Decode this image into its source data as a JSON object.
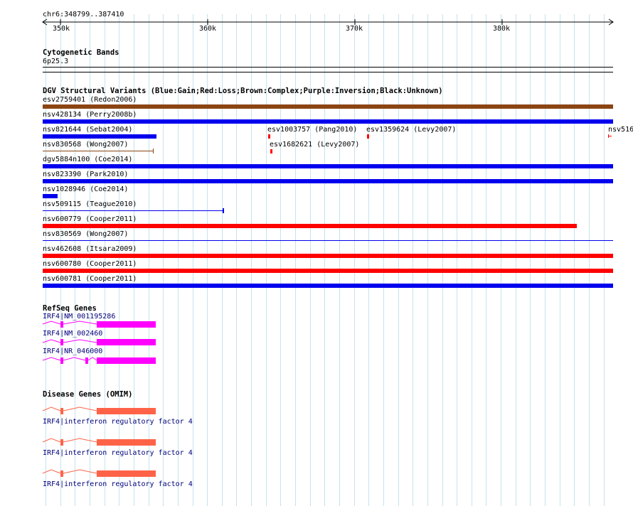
{
  "ruler": {
    "location": "chr6:348799..387410",
    "ticks": [
      "350k",
      "360k",
      "370k",
      "380k"
    ]
  },
  "cytobands": {
    "title": "Cytogenetic Bands",
    "band": "6p25.3"
  },
  "dgv": {
    "title": "DGV Structural Variants (Blue:Gain;Red:Loss;Brown:Complex;Purple:Inversion;Black:Unknown)",
    "colors": {
      "gain": "#0000ee",
      "loss": "#ff0000",
      "complex": "#8b4513"
    },
    "variants": [
      {
        "label": "esv2759401 (Redon2006)",
        "type": "complex"
      },
      {
        "label": "nsv428134 (Perry2008b)",
        "type": "gain"
      },
      {
        "label": "nsv821644 (Sebat2004)",
        "type": "gain"
      },
      {
        "label": "esv1003757 (Pang2010)",
        "type": "loss"
      },
      {
        "label": "esv1359624 (Levy2007)",
        "type": "loss"
      },
      {
        "label": "nsv516",
        "type": "loss"
      },
      {
        "label": "nsv830568 (Wong2007)",
        "type": "complex"
      },
      {
        "label": "esv1682621 (Levy2007)",
        "type": "loss"
      },
      {
        "label": "dgv5884n100 (Coe2014)",
        "type": "gain"
      },
      {
        "label": "nsv823390 (Park2010)",
        "type": "gain"
      },
      {
        "label": "nsv1028946 (Coe2014)",
        "type": "gain"
      },
      {
        "label": "nsv509115 (Teague2010)",
        "type": "gain"
      },
      {
        "label": "nsv600779 (Cooper2011)",
        "type": "loss"
      },
      {
        "label": "nsv830569 (Wong2007)",
        "type": "gain"
      },
      {
        "label": "nsv462608 (Itsara2009)",
        "type": "loss"
      },
      {
        "label": "nsv600780 (Cooper2011)",
        "type": "loss"
      },
      {
        "label": "nsv600781 (Cooper2011)",
        "type": "gain"
      }
    ]
  },
  "refseq": {
    "title": "RefSeq Genes",
    "color": "#ff00ff",
    "genes": [
      {
        "label": "IRF4|NM_001195286"
      },
      {
        "label": "IRF4|NM_002460"
      },
      {
        "label": "IRF4|NR_046000"
      }
    ]
  },
  "omim": {
    "title": "Disease Genes (OMIM)",
    "color": "#ff6347",
    "genes": [
      {
        "label": "IRF4|interferon regulatory factor 4"
      },
      {
        "label": "IRF4|interferon regulatory factor 4"
      },
      {
        "label": "IRF4|interferon regulatory factor 4"
      }
    ]
  }
}
